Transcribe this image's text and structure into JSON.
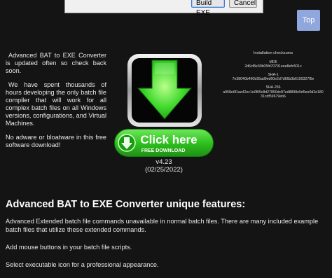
{
  "dialog": {
    "build_label": "Build EXE",
    "cancel_label": "Cancel"
  },
  "top_button": "Top",
  "intro": {
    "p1": "Advanced BAT to EXE Converter is updated often so check back soon.",
    "p2": "We have spent thousands of hours developing the only batch file compiler that will work for all complex batch files on all Windows versions, configurations, and Virtual Machines.",
    "p3": "No adware or bloatware in this free software download!"
  },
  "download": {
    "button_main": "Click here",
    "button_sub": "FREE DOWNLOAD",
    "version": "v4.23",
    "date": "(02/25/2022)"
  },
  "checksums": {
    "title": "Installation checksums",
    "md5_label": "MD5",
    "md5_value": "2d6cf8e30b05fd70791eee8efc501c",
    "sha1_label": "SHA-1",
    "sha1_value": "7e38040b490b95ad9ed60e2d7d66b3b6100327f5e",
    "sha256_label": "SHA-256",
    "sha256_value": "a958e6f1ae42ec1e0f09c8d27850dc87ed8898e5d5ee0d2e18031cdf59679eb6"
  },
  "features": {
    "heading": "Advanced BAT to EXE Converter unique features:",
    "items": [
      "Advanced Extended batch file commands unavailable in normal batch files. There are many included example batch files that utilize these extended commands.",
      "Add mouse buttons in your batch file scripts.",
      "Select executable icon for a professional appearance."
    ]
  },
  "colors": {
    "background": "#141414",
    "top_button": "#8fa7dd",
    "download_green": "#2fc21f"
  }
}
